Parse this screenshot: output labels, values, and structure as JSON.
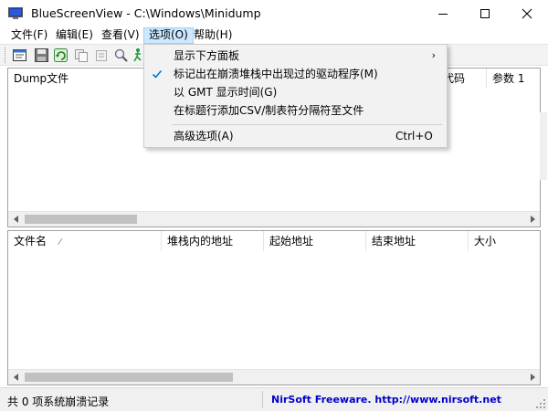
{
  "window": {
    "title": "BlueScreenView  -  C:\\Windows\\Minidump",
    "buttons": {
      "minimize": "minimize-icon",
      "maximize": "maximize-icon",
      "close": "close-icon"
    }
  },
  "menubar": [
    {
      "label": "文件(F)"
    },
    {
      "label": "编辑(E)"
    },
    {
      "label": "查看(V)"
    },
    {
      "label": "选项(O)",
      "active": true
    },
    {
      "label": "帮助(H)"
    }
  ],
  "toolbar": {
    "icons": [
      "properties-icon",
      "save-icon",
      "refresh-icon",
      "copy-icon",
      "copy-alt-icon",
      "search-icon",
      "run-icon"
    ]
  },
  "upper_table": {
    "columns": [
      "Dump文件",
      "代码",
      "参数 1"
    ]
  },
  "lower_table": {
    "columns": [
      "文件名",
      "堆栈内的地址",
      "起始地址",
      "结束地址",
      "大小"
    ],
    "sort_indicator": "⁄"
  },
  "options_menu": {
    "items": [
      {
        "label": "显示下方面板",
        "submenu": true
      },
      {
        "label": "标记出在崩溃堆栈中出现过的驱动程序(M)",
        "checked": true
      },
      {
        "label": "以 GMT 显示时间(G)"
      },
      {
        "label": "在标题行添加CSV/制表符分隔符至文件"
      },
      {
        "label": "高级选项(A)",
        "shortcut": "Ctrl+O"
      }
    ]
  },
  "statusbar": {
    "summary": "共 0 项系统崩溃记录",
    "link": "NirSoft Freeware.  http://www.nirsoft.net"
  },
  "colors": {
    "accent": "#0078d7",
    "menu_highlight": "#cce8ff",
    "link": "#0000cc"
  }
}
